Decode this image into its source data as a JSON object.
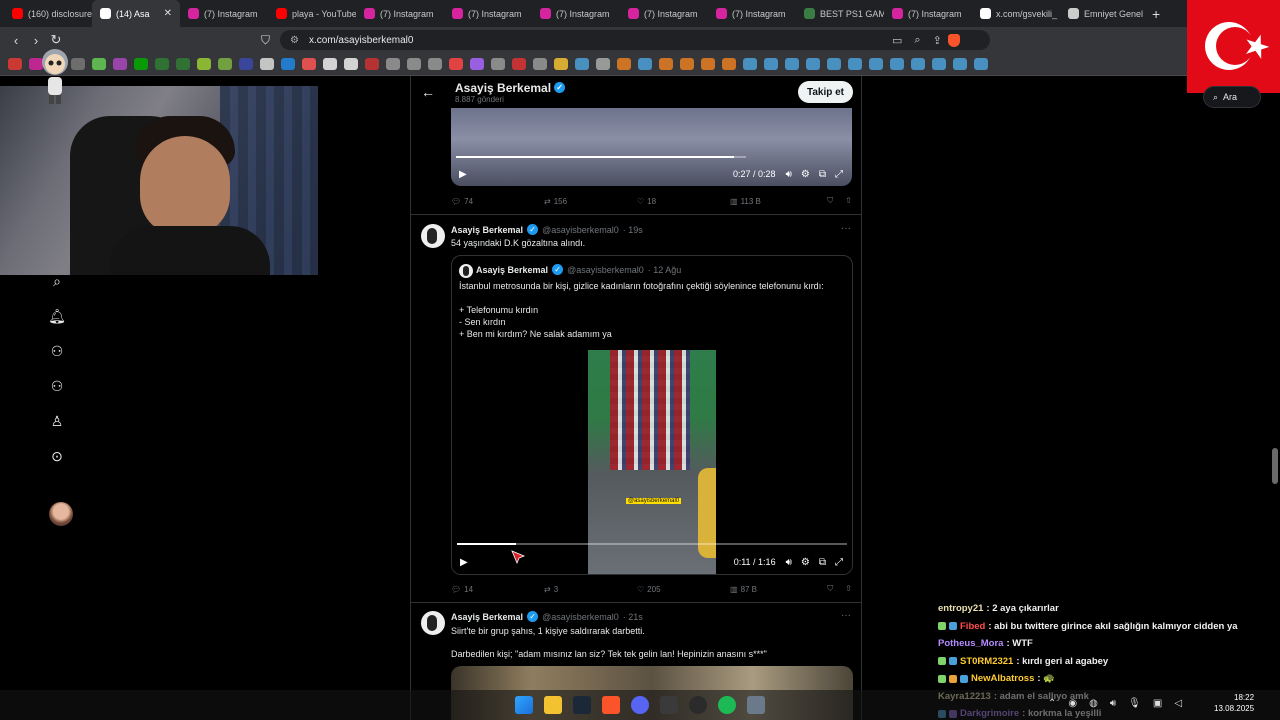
{
  "browser": {
    "tabs": [
      {
        "label": "(160) disclosure",
        "color": "#ff0000"
      },
      {
        "label": "(14) Asa",
        "color": "#ffffff",
        "active": true
      },
      {
        "label": "(7) Instagram",
        "color": "#d6249f"
      },
      {
        "label": "playa - YouTube",
        "color": "#ff0000"
      },
      {
        "label": "(7) Instagram",
        "color": "#d6249f"
      },
      {
        "label": "(7) Instagram",
        "color": "#d6249f"
      },
      {
        "label": "(7) Instagram",
        "color": "#d6249f"
      },
      {
        "label": "(7) Instagram",
        "color": "#d6249f"
      },
      {
        "label": "(7) Instagram",
        "color": "#d6249f"
      },
      {
        "label": "BEST PS1 GAMI",
        "color": "#3a7d44"
      },
      {
        "label": "(7) Instagram",
        "color": "#d6249f"
      },
      {
        "label": "x.com/gsvekili_",
        "color": "#ffffff"
      },
      {
        "label": "Emniyet Genel",
        "color": "#cccccc"
      }
    ],
    "url": "x.com/asayisberkemal0"
  },
  "profile": {
    "name": "Asayiş Berkemal",
    "post_count": "8.887 gönderi",
    "follow_label": "Takip et"
  },
  "video1": {
    "time": "0:27 / 0:28",
    "progress": 0.96,
    "stats": {
      "replies": "74",
      "reposts": "156",
      "likes": "18",
      "views": "113 B"
    }
  },
  "tweet2": {
    "name": "Asayiş Berkemal",
    "handle": "@asayisberkemal0",
    "time": "· 19s",
    "text": "54 yaşındaki D.K gözaltına alındı.",
    "quote": {
      "name": "Asayiş Berkemal",
      "handle": "@asayisberkemal0",
      "time": "· 12 Ağu",
      "lines": [
        "İstanbul metrosunda bir kişi, gizlice kadınların fotoğrafını çektiği söylenince telefonunu kırdı:",
        "",
        "+ Telefonumu kırdın",
        "- Sen kırdın",
        "+ Ben mi kırdım? Ne salak adamım ya"
      ],
      "watermark": "@asayisberkemal0",
      "video_time": "0:11 / 1:16",
      "progress": 0.15
    },
    "stats": {
      "replies": "14",
      "reposts": "3",
      "likes": "205",
      "views": "87 B"
    }
  },
  "tweet3": {
    "name": "Asayiş Berkemal",
    "handle": "@asayisberkemal0",
    "time": "· 21s",
    "line1": "Siirt'te bir grup şahıs, 1 kişiye saldırarak darbetti.",
    "line2": "Darbedilen kişi; \"adam mısınız lan siz? Tek tek gelin lan! Hepinizin anasını s***\""
  },
  "search": {
    "placeholder": "Ara"
  },
  "chat": [
    {
      "user": "entropy21",
      "color": "#e8e0b0",
      "msg": ": 2 aya çıkarırlar",
      "badges": []
    },
    {
      "user": "Fibed",
      "color": "#ff4d4d",
      "msg": ": abi bu twittere girince akıl sağlığın kalmıyor cidden ya",
      "badges": [
        "#7fd36b",
        "#4aa0d8"
      ]
    },
    {
      "user": "Potheus_Mora",
      "color": "#b58cff",
      "msg": ": WTF",
      "badges": []
    },
    {
      "user": "ST0RM2321",
      "color": "#ffcc33",
      "msg": ": kırdı geri al agabey",
      "badges": [
        "#7fd36b",
        "#4aa0d8"
      ]
    },
    {
      "user": "NewAlbatross",
      "color": "#ffcc33",
      "msg": ": 🐢",
      "badges": [
        "#7fd36b",
        "#e8a33a",
        "#4aa0d8"
      ]
    },
    {
      "user": "Kayra12213",
      "color": "#e8e0b0",
      "msg": ": adam el sallıyo amk",
      "badges": []
    },
    {
      "user": "Darkgrimoire",
      "color": "#b58cff",
      "msg": ": korkma la yeşilli",
      "badges": [
        "#4aa0d8",
        "#8a6bd8"
      ]
    }
  ],
  "clock": {
    "time": "18:22",
    "date": "13.08.2025"
  }
}
